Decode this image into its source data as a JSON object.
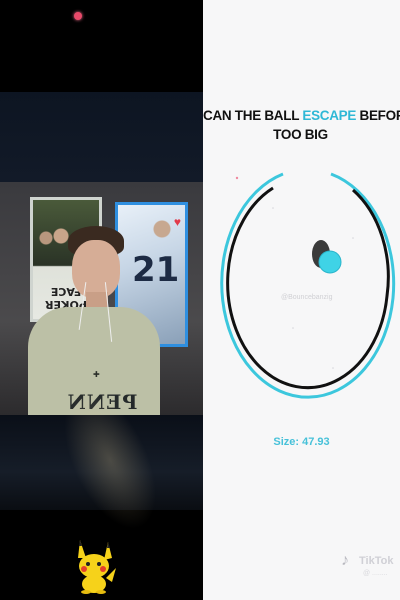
{
  "left_panel": {
    "poster_left_title": "POKER FACE",
    "poster_right_number": "21",
    "poster_right_suit": "♥",
    "shirt_text": "PENN"
  },
  "right_panel": {
    "title_part1": "CAN THE BALL ",
    "title_highlight": "ESCAPE",
    "title_part2": " BEFORE ITS",
    "title_line2": "TOO BIG",
    "size_label": "Size: 47.93",
    "watermark": "@Bouncebanzig",
    "tiktok_name": "TikTok",
    "tiktok_handle": "@ ........"
  },
  "colors": {
    "accent": "#2fb8d6",
    "ring_outer": "#3cc7dd",
    "ball": "#3fd3e6",
    "background_right": "#f7f7f8"
  },
  "icons": [
    "record-dot-icon",
    "pikachu-sticker-icon",
    "tiktok-logo-icon"
  ]
}
